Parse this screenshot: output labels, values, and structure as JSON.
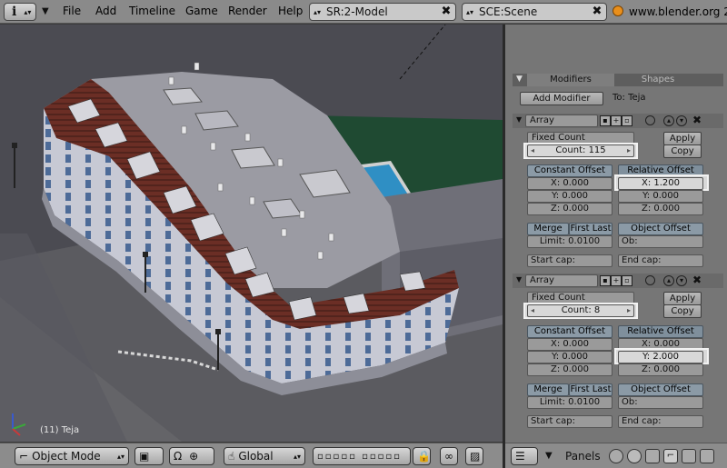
{
  "header": {
    "info_icon": "info-icon",
    "menus": [
      "File",
      "Add",
      "Timeline",
      "Game",
      "Render",
      "Help"
    ],
    "screen_field": "SR:2-Model",
    "scene_field": "SCE:Scene",
    "url_text": "www.blender.org 2"
  },
  "viewport": {
    "object_label": "(11) Teja"
  },
  "viewport_footer": {
    "mode": "Object Mode",
    "orientation": "Global"
  },
  "panel": {
    "tabs": [
      "Modifiers",
      "Shapes"
    ],
    "add_modifier": "Add Modifier",
    "to_label": "To: Teja",
    "modifiers": [
      {
        "type": "Array",
        "fit_mode": "Fixed Count",
        "count": "Count: 115",
        "apply": "Apply",
        "copy": "Copy",
        "constant_offset": "Constant Offset",
        "relative_offset": "Relative Offset",
        "const_x": "X: 0.000",
        "const_y": "Y: 0.000",
        "const_z": "Z: 0.000",
        "rel_x": "X: 1.200",
        "rel_y": "Y: 0.000",
        "rel_z": "Z: 0.000",
        "merge": "Merge",
        "first_last": "First Last",
        "limit": "Limit: 0.0100",
        "object_offset": "Object Offset",
        "ob": "Ob:",
        "start_cap": "Start cap:",
        "end_cap": "End cap:"
      },
      {
        "type": "Array",
        "fit_mode": "Fixed Count",
        "count": "Count: 8",
        "apply": "Apply",
        "copy": "Copy",
        "constant_offset": "Constant Offset",
        "relative_offset": "Relative Offset",
        "const_x": "X: 0.000",
        "const_y": "Y: 0.000",
        "const_z": "Z: 0.000",
        "rel_x": "X: 0.000",
        "rel_y": "Y: 2.000",
        "rel_z": "Z: 0.000",
        "merge": "Merge",
        "first_last": "First Last",
        "limit": "Limit: 0.0100",
        "object_offset": "Object Offset",
        "ob": "Ob:",
        "start_cap": "Start cap:",
        "end_cap": "End cap:"
      }
    ]
  },
  "panel_footer": {
    "panels_label": "Panels"
  },
  "colors": {
    "header_bg": "#8a8a8a",
    "viewport_bg": "#4b4b52",
    "panel_bg": "#767676",
    "highlight": "#f2f2f2",
    "roof_tile": "#6b2e25",
    "pool": "#2f8fc4"
  }
}
